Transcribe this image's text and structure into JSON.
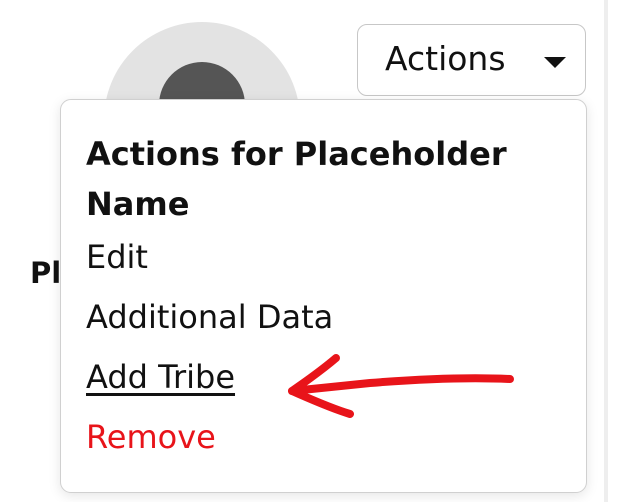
{
  "profile": {
    "name_peek": "Pl"
  },
  "actions_button": {
    "label": "Actions",
    "icon": "caret-down-icon"
  },
  "menu": {
    "header": "Actions for Placeholder Name",
    "items": [
      {
        "label": "Edit",
        "color": "#111111"
      },
      {
        "label": "Additional Data",
        "color": "#111111"
      },
      {
        "label": "Add Tribe",
        "color": "#111111",
        "underlined": true
      },
      {
        "label": "Remove",
        "color": "#e8141a"
      }
    ]
  },
  "annotation": {
    "icon": "red-arrow-icon",
    "color": "#e8141a",
    "points_to": "Add Tribe"
  }
}
